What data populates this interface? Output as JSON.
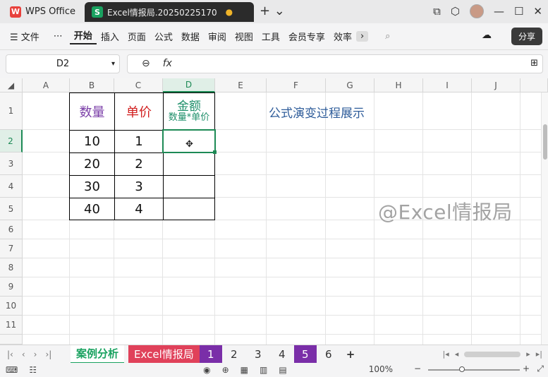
{
  "titlebar": {
    "home_tab": "WPS Office",
    "home_logo": "W",
    "doc_tab": "Excel情报局.20250225170",
    "doc_logo": "S",
    "unsaved_dot": "●",
    "new_tab": "+ ⌄"
  },
  "menubar": {
    "items": [
      "☰ 文件",
      "⋯",
      "开始",
      "插入",
      "页面",
      "公式",
      "数据",
      "审阅",
      "视图",
      "工具",
      "会员专享",
      "效率"
    ],
    "more": "›",
    "search_icon": "⌕",
    "share": "分享",
    "cloud_icon": "☁"
  },
  "formula": {
    "cell_ref": "D2",
    "zoom_icon": "⊖",
    "fx": "fx",
    "content": "",
    "expand_icon": "⊞"
  },
  "columns": [
    "A",
    "B",
    "C",
    "D",
    "E",
    "F",
    "G",
    "H",
    "I",
    "J"
  ],
  "rows": [
    "1",
    "2",
    "3",
    "4",
    "5",
    "6",
    "7",
    "8",
    "9",
    "10",
    "11"
  ],
  "table": {
    "qty_header": "数量",
    "price_header": "单价",
    "amount_header": "金额",
    "amount_subheader": "数量*单价",
    "qty": [
      "10",
      "20",
      "30",
      "40"
    ],
    "price": [
      "1",
      "2",
      "3",
      "4"
    ]
  },
  "note": "公式演变过程展示",
  "watermark": "@Excel情报局",
  "sheets": {
    "nav": [
      "|‹",
      "‹",
      "›",
      "›|"
    ],
    "tabs": [
      "案例分析",
      "Excel情报局",
      "1",
      "2",
      "3",
      "4",
      "5",
      "6"
    ],
    "add": "+"
  },
  "status": {
    "zoom": "100%",
    "minus": "−",
    "plus": "+"
  },
  "colors": {
    "accent_green": "#1d8a55",
    "qty_purple": "#7b3fa8",
    "price_red": "#d11f1f",
    "amount_teal": "#1e8f6a",
    "note_blue": "#2e5c9a"
  }
}
